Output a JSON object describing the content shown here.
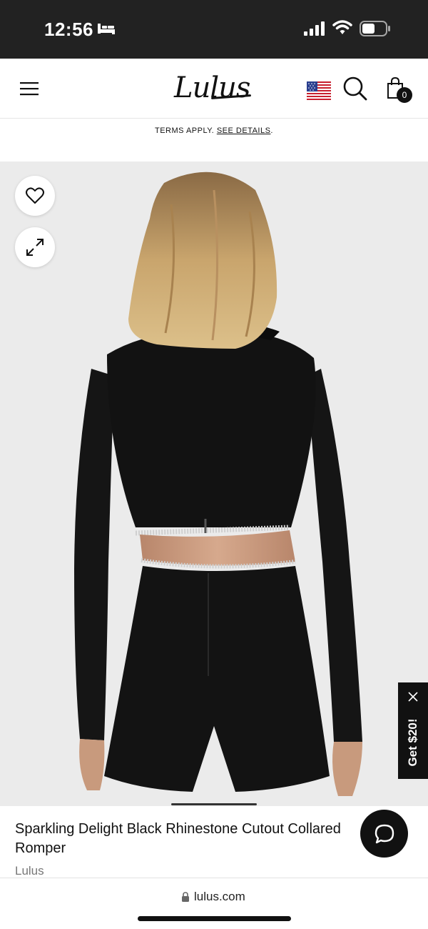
{
  "status": {
    "time": "12:56"
  },
  "nav": {
    "logo": "Lulus",
    "cart_count": "0"
  },
  "promo": {
    "text": "TERMS APPLY.",
    "link": "SEE DETAILS",
    "end": "."
  },
  "promo_tab": {
    "label": "Get $20!"
  },
  "product": {
    "title": "Sparkling Delight Black Rhinestone Cutout Collared Romper",
    "brand": "Lulus"
  },
  "browser": {
    "url": "lulus.com"
  },
  "icons": [
    "bed-icon",
    "signal-icon",
    "wifi-icon",
    "battery-icon",
    "hamburger-icon",
    "flag-icon",
    "search-icon",
    "bag-icon",
    "heart-icon",
    "expand-icon",
    "close-icon",
    "chat-icon",
    "lock-icon"
  ]
}
